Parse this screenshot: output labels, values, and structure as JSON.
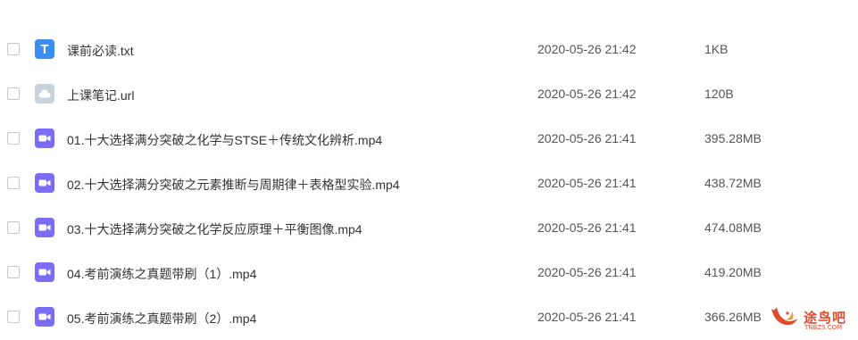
{
  "files": [
    {
      "name": "课前必读.txt",
      "date": "2020-05-26 21:42",
      "size": "1KB",
      "icon": "text-file-icon",
      "icon_glyph": "T",
      "kind": "txt"
    },
    {
      "name": "上课笔记.url",
      "date": "2020-05-26 21:42",
      "size": "120B",
      "icon": "cloud-link-icon",
      "kind": "url"
    },
    {
      "name": "01.十大选择满分突破之化学与STSE＋传统文化辨析.mp4",
      "date": "2020-05-26 21:41",
      "size": "395.28MB",
      "icon": "video-file-icon",
      "kind": "video"
    },
    {
      "name": "02.十大选择满分突破之元素推断与周期律＋表格型实验.mp4",
      "date": "2020-05-26 21:41",
      "size": "438.72MB",
      "icon": "video-file-icon",
      "kind": "video"
    },
    {
      "name": "03.十大选择满分突破之化学反应原理＋平衡图像.mp4",
      "date": "2020-05-26 21:41",
      "size": "474.08MB",
      "icon": "video-file-icon",
      "kind": "video"
    },
    {
      "name": "04.考前演练之真题带刷（1）.mp4",
      "date": "2020-05-26 21:41",
      "size": "419.20MB",
      "icon": "video-file-icon",
      "kind": "video"
    },
    {
      "name": "05.考前演练之真题带刷（2）.mp4",
      "date": "2020-05-26 21:41",
      "size": "366.26MB",
      "icon": "video-file-icon",
      "kind": "video"
    }
  ],
  "watermark": {
    "text": "途鸟吧",
    "subtext": "TNBZS.COM",
    "color": "#e24a2c"
  },
  "colors": {
    "txt_icon": "#3b8df1",
    "video_icon": "#7b6cf6",
    "url_icon": "#c9d3de"
  }
}
